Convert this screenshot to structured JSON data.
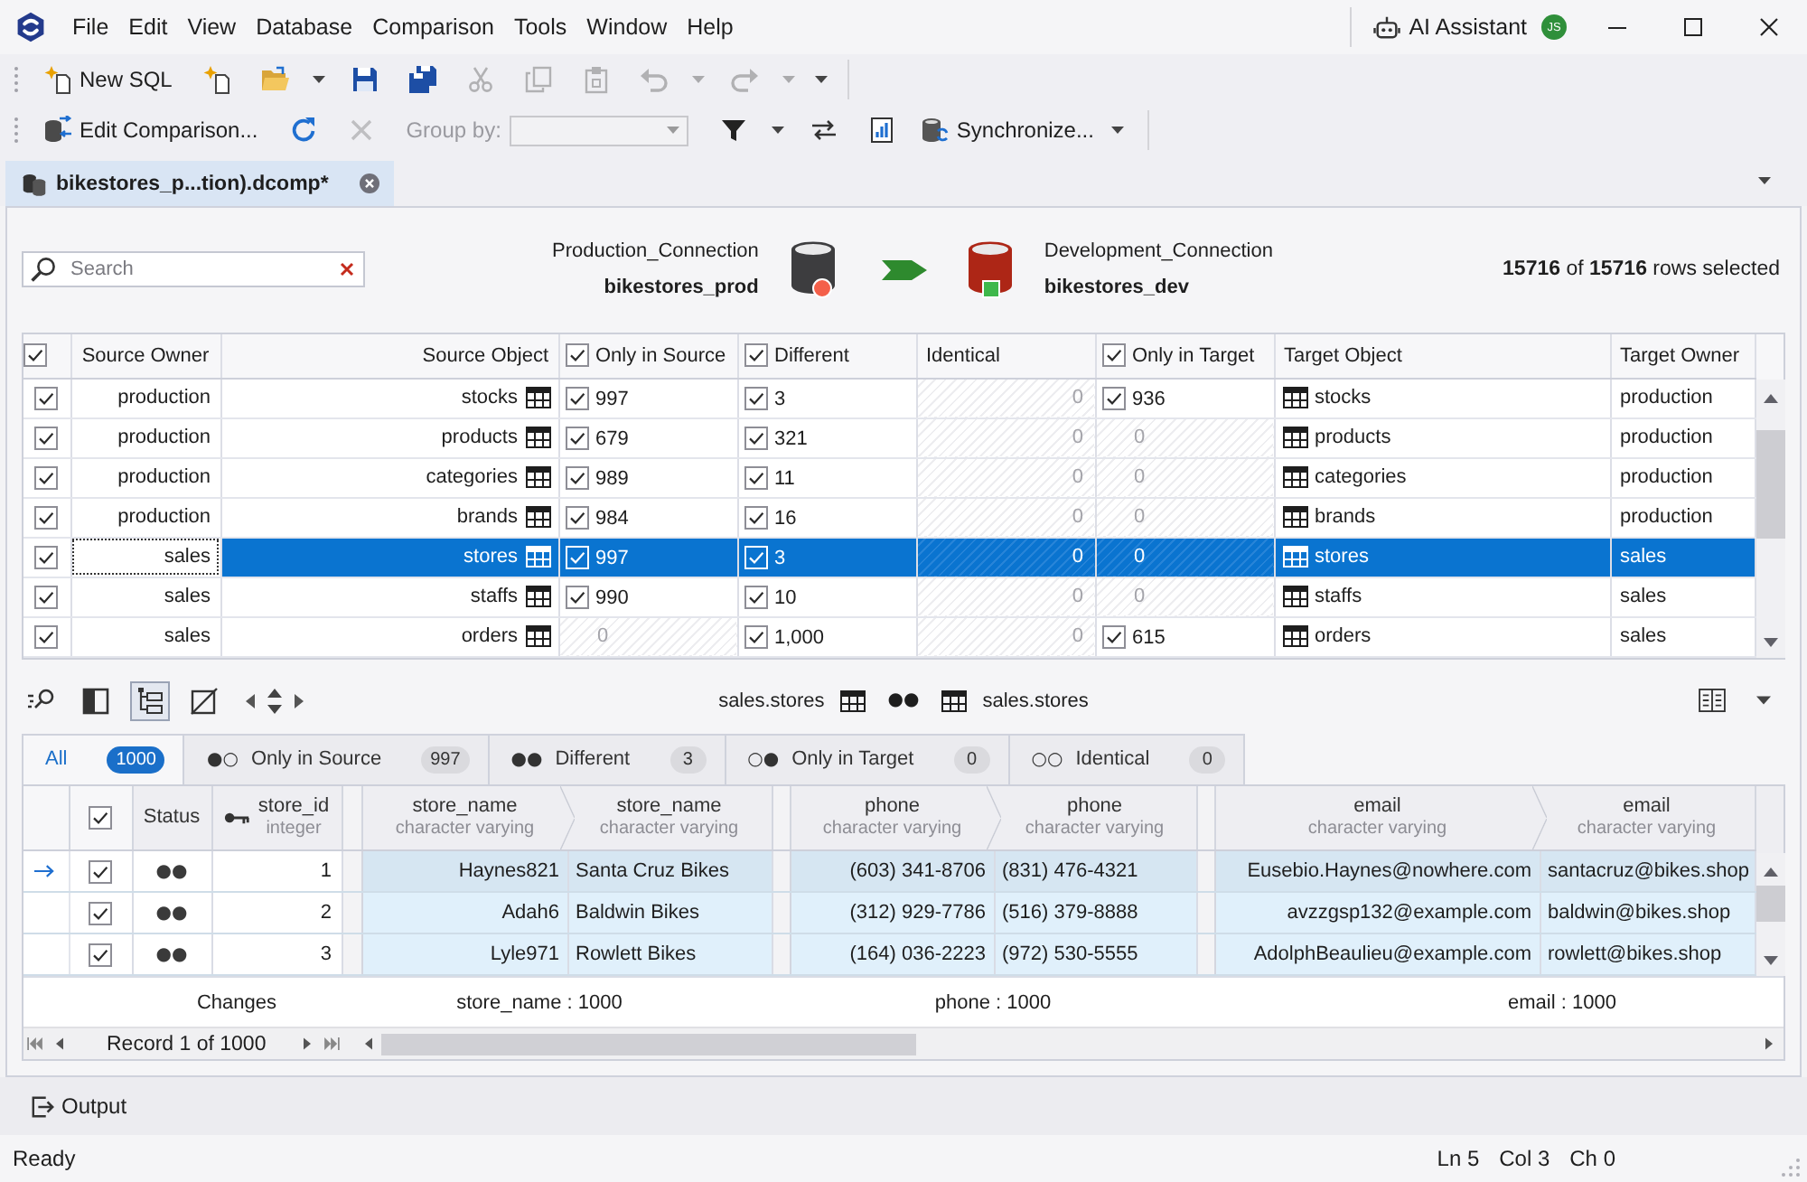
{
  "title_bar": {
    "menu": [
      "File",
      "Edit",
      "View",
      "Database",
      "Comparison",
      "Tools",
      "Window",
      "Help"
    ],
    "ai_assistant": "AI Assistant",
    "user_initials": "JS"
  },
  "toolbar_1": [
    {
      "kind": "button",
      "label": "New SQL",
      "disabled": false
    },
    {
      "kind": "icon",
      "disabled": false
    },
    {
      "kind": "split",
      "disabled": false
    },
    {
      "kind": "icon",
      "disabled": false
    },
    {
      "kind": "icon",
      "disabled": false
    },
    {
      "kind": "icon",
      "disabled": true
    },
    {
      "kind": "icon",
      "disabled": true
    },
    {
      "kind": "icon",
      "disabled": true
    },
    {
      "kind": "split",
      "disabled": true
    },
    {
      "kind": "split",
      "disabled": true
    }
  ],
  "toolbar_2": [
    {
      "kind": "button",
      "label": "Edit Comparison...",
      "disabled": false
    },
    {
      "kind": "icon",
      "disabled": false
    },
    {
      "kind": "icon",
      "disabled": true
    },
    {
      "kind": "combo",
      "label": "Group by:",
      "disabled": true
    },
    {
      "kind": "split",
      "disabled": false
    },
    {
      "kind": "icon",
      "disabled": false
    },
    {
      "kind": "icon",
      "disabled": false
    },
    {
      "kind": "split",
      "label": "Synchronize...",
      "disabled": false
    }
  ],
  "document_tabs": [
    {
      "title": "bikestores_p...tion).dcomp*",
      "selected": true
    }
  ],
  "comparison_header": {
    "search": {
      "placeholder": "Search"
    },
    "source": {
      "connection": "Production_Connection",
      "database": "bikestores_prod"
    },
    "target": {
      "connection": "Development_Connection",
      "database": "bikestores_dev"
    },
    "selection_summary": "**15716** of **15716** rows selected"
  },
  "objects_table": {
    "all_checked": true,
    "columns": [
      {
        "kind": "source-owner",
        "label": "Source Owner"
      },
      {
        "kind": "source-object",
        "label": "Source Object"
      },
      {
        "kind": "count",
        "label": "Only in Source",
        "checked": true
      },
      {
        "kind": "count",
        "label": "Different",
        "checked": true
      },
      {
        "kind": "identical",
        "label": "Identical"
      },
      {
        "kind": "count",
        "label": "Only in Target",
        "checked": true
      },
      {
        "kind": "target-object",
        "label": "Target Object"
      },
      {
        "kind": "target-owner",
        "label": "Target Owner"
      }
    ],
    "rows": [
      {
        "checked": true,
        "selected": false,
        "focused": false,
        "cells": [
          {
            "text": "production"
          },
          {
            "text": "stocks"
          },
          {
            "text": "997",
            "empty": false,
            "checked": true
          },
          {
            "text": "3",
            "empty": false,
            "checked": true
          },
          {
            "text": "0",
            "empty": true
          },
          {
            "text": "936",
            "empty": false,
            "checked": true
          },
          {
            "text": "stocks"
          },
          {
            "text": "production"
          }
        ]
      },
      {
        "checked": true,
        "selected": false,
        "focused": false,
        "cells": [
          {
            "text": "production"
          },
          {
            "text": "products"
          },
          {
            "text": "679",
            "empty": false,
            "checked": true
          },
          {
            "text": "321",
            "empty": false,
            "checked": true
          },
          {
            "text": "0",
            "empty": true
          },
          {
            "text": "0",
            "empty": true
          },
          {
            "text": "products"
          },
          {
            "text": "production"
          }
        ]
      },
      {
        "checked": true,
        "selected": false,
        "focused": false,
        "cells": [
          {
            "text": "production"
          },
          {
            "text": "categories"
          },
          {
            "text": "989",
            "empty": false,
            "checked": true
          },
          {
            "text": "11",
            "empty": false,
            "checked": true
          },
          {
            "text": "0",
            "empty": true
          },
          {
            "text": "0",
            "empty": true
          },
          {
            "text": "categories"
          },
          {
            "text": "production"
          }
        ]
      },
      {
        "checked": true,
        "selected": false,
        "focused": false,
        "cells": [
          {
            "text": "production"
          },
          {
            "text": "brands"
          },
          {
            "text": "984",
            "empty": false,
            "checked": true
          },
          {
            "text": "16",
            "empty": false,
            "checked": true
          },
          {
            "text": "0",
            "empty": true
          },
          {
            "text": "0",
            "empty": true
          },
          {
            "text": "brands"
          },
          {
            "text": "production"
          }
        ]
      },
      {
        "checked": true,
        "selected": true,
        "focused": true,
        "cells": [
          {
            "text": "sales"
          },
          {
            "text": "stores"
          },
          {
            "text": "997",
            "empty": false,
            "checked": true
          },
          {
            "text": "3",
            "empty": false,
            "checked": true
          },
          {
            "text": "0",
            "empty": true
          },
          {
            "text": "0",
            "empty": true
          },
          {
            "text": "stores"
          },
          {
            "text": "sales"
          }
        ]
      },
      {
        "checked": true,
        "selected": false,
        "focused": false,
        "cells": [
          {
            "text": "sales"
          },
          {
            "text": "staffs"
          },
          {
            "text": "990",
            "empty": false,
            "checked": true
          },
          {
            "text": "10",
            "empty": false,
            "checked": true
          },
          {
            "text": "0",
            "empty": true
          },
          {
            "text": "0",
            "empty": true
          },
          {
            "text": "staffs"
          },
          {
            "text": "sales"
          }
        ]
      },
      {
        "checked": true,
        "selected": false,
        "focused": false,
        "cells": [
          {
            "text": "sales"
          },
          {
            "text": "orders"
          },
          {
            "text": "0",
            "empty": true
          },
          {
            "text": "1,000",
            "empty": false,
            "checked": true
          },
          {
            "text": "0",
            "empty": true
          },
          {
            "text": "615",
            "empty": false,
            "checked": true
          },
          {
            "text": "orders"
          },
          {
            "text": "sales"
          }
        ]
      }
    ]
  },
  "detail_toolbar": {
    "buttons": [
      {
        "on": false
      },
      {
        "on": false
      },
      {
        "on": true
      },
      {
        "on": false
      }
    ],
    "source_table": "sales.stores",
    "status": "●●",
    "target_table": "sales.stores"
  },
  "record_filter_tabs": [
    {
      "label": "All",
      "count": "1000",
      "selected": true
    },
    {
      "dots": "●○",
      "label": "Only in Source",
      "count": "997",
      "selected": false
    },
    {
      "dots": "●●",
      "label": "Different",
      "count": "3",
      "selected": false
    },
    {
      "dots": "○●",
      "label": "Only in Target",
      "count": "0",
      "selected": false
    },
    {
      "dots": "○○",
      "label": "Identical",
      "count": "0",
      "selected": false
    }
  ],
  "records_table": {
    "all_checked": true,
    "key_columns": [
      {
        "kind": "status",
        "label": "Status"
      },
      {
        "kind": "key",
        "label": "store_id",
        "type": "integer"
      }
    ],
    "column_pairs": [
      {
        "source": {
          "label": "store_name",
          "type": "character varying"
        },
        "target": {
          "label": "store_name",
          "type": "character varying"
        }
      },
      {
        "source": {
          "label": "phone",
          "type": "character varying"
        },
        "target": {
          "label": "phone",
          "type": "character varying"
        }
      },
      {
        "source": {
          "label": "email",
          "type": "character varying"
        },
        "target": {
          "label": "email",
          "type": "character varying"
        }
      }
    ],
    "rows": [
      {
        "current": true,
        "checked": true,
        "key_values": [
          "●●",
          "1"
        ],
        "pairs": [
          [
            "Haynes821",
            "Santa Cruz Bikes"
          ],
          [
            "(603) 341-8706",
            "(831) 476-4321"
          ],
          [
            "Eusebio.Haynes@nowhere.com",
            "santacruz@bikes.shop"
          ]
        ]
      },
      {
        "current": false,
        "checked": true,
        "key_values": [
          "●●",
          "2"
        ],
        "pairs": [
          [
            "Adah6",
            "Baldwin Bikes"
          ],
          [
            "(312) 929-7786",
            "(516) 379-8888"
          ],
          [
            "avzzgsp132@example.com",
            "baldwin@bikes.shop"
          ]
        ]
      },
      {
        "current": false,
        "checked": true,
        "key_values": [
          "●●",
          "3"
        ],
        "pairs": [
          [
            "Lyle971",
            "Rowlett Bikes"
          ],
          [
            "(164) 036-2223",
            "(972) 530-5555"
          ],
          [
            "AdolphBeaulieu@example.com",
            "rowlett@bikes.shop"
          ]
        ]
      }
    ],
    "summary": {
      "label": "Changes",
      "counts": [
        "store_name : 1000",
        "phone : 1000",
        "email : 1000"
      ]
    },
    "navigator": "Record 1 of 1000"
  },
  "output_panel": {
    "label": "Output"
  },
  "status_bar": {
    "message": "Ready",
    "position": [
      "Ln 5",
      "Col 3",
      "Ch 0"
    ]
  }
}
